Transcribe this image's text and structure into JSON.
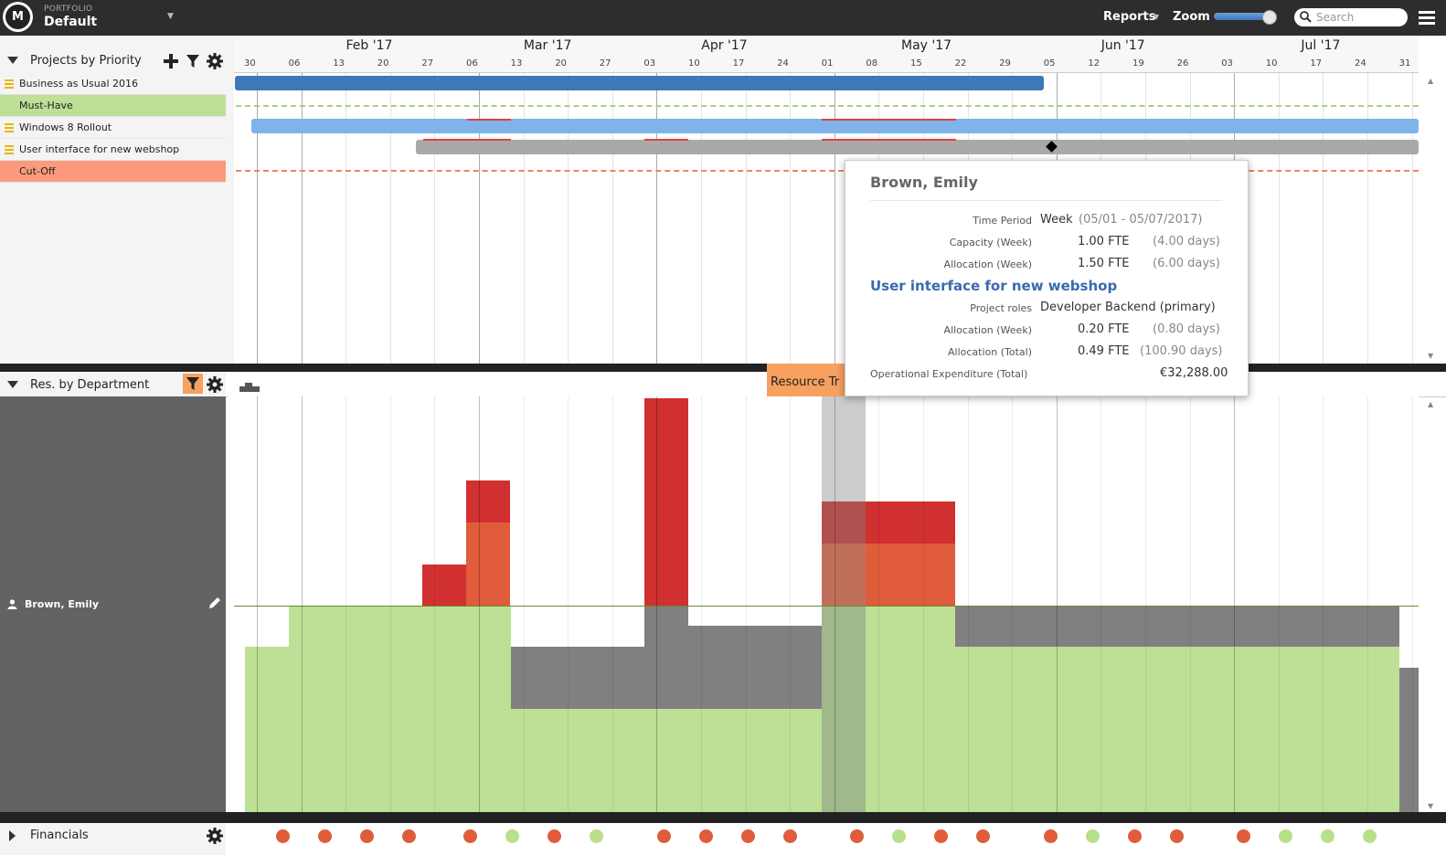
{
  "app": {
    "portfolio_label": "PORTFOLIO",
    "portfolio_name": "Default"
  },
  "topbar": {
    "reports_label": "Reports",
    "zoom_label": "Zoom",
    "search_placeholder": "Search"
  },
  "projects_panel": {
    "title": "Projects by Priority",
    "rows": [
      {
        "label": "Business as Usual 2016",
        "type": "project"
      },
      {
        "label": "Must-Have",
        "type": "separator"
      },
      {
        "label": "Windows 8 Rollout",
        "type": "project"
      },
      {
        "label": "User interface for new webshop",
        "type": "project"
      },
      {
        "label": "Cut-Off",
        "type": "cutoff"
      }
    ]
  },
  "timeline": {
    "months": [
      "Feb '17",
      "Mar '17",
      "Apr '17",
      "May '17",
      "Jun '17",
      "Jul '17"
    ],
    "days": [
      "30",
      "06",
      "13",
      "20",
      "27",
      "06",
      "13",
      "20",
      "27",
      "03",
      "10",
      "17",
      "24",
      "01",
      "08",
      "15",
      "22",
      "29",
      "05",
      "12",
      "19",
      "26",
      "03",
      "10",
      "17",
      "24",
      "31"
    ]
  },
  "resources_panel": {
    "title": "Res. by Department",
    "resource_name": "Brown, Emily",
    "tab_label": "Resource Tr"
  },
  "tooltip": {
    "name": "Brown, Emily",
    "time_period_label": "Time Period",
    "time_period_value": "Week",
    "time_period_range": "(05/01 - 05/07/2017)",
    "capacity_label": "Capacity (Week)",
    "capacity_fte": "1.00 FTE",
    "capacity_days": "(4.00 days)",
    "allocation_label": "Allocation (Week)",
    "allocation_fte": "1.50 FTE",
    "allocation_days": "(6.00 days)",
    "project_name": "User interface for new webshop",
    "project_roles_label": "Project roles",
    "project_roles_value": "Developer Backend (primary)",
    "proj_alloc_week_label": "Allocation (Week)",
    "proj_alloc_week_fte": "0.20 FTE",
    "proj_alloc_week_days": "(0.80 days)",
    "proj_alloc_total_label": "Allocation (Total)",
    "proj_alloc_total_fte": "0.49 FTE",
    "proj_alloc_total_days": "(100.90 days)",
    "opex_label": "Operational Expenditure (Total)",
    "opex_value": "€32,288.00"
  },
  "financials_panel": {
    "title": "Financials",
    "dots": [
      "red",
      "red",
      "red",
      "red",
      "red",
      "green",
      "red",
      "green",
      "red",
      "red",
      "red",
      "red",
      "red",
      "green",
      "red",
      "red",
      "red",
      "green",
      "red",
      "red",
      "red",
      "green",
      "green",
      "green"
    ]
  },
  "colors": {
    "green": "#bde096",
    "gray": "#808080",
    "orange": "#e05c3a",
    "red": "#d03030",
    "blue_dark": "#3d78b8",
    "blue_light": "#7fb3ea",
    "must_have": "#bde096",
    "cut_off": "#fb9a7c"
  }
}
